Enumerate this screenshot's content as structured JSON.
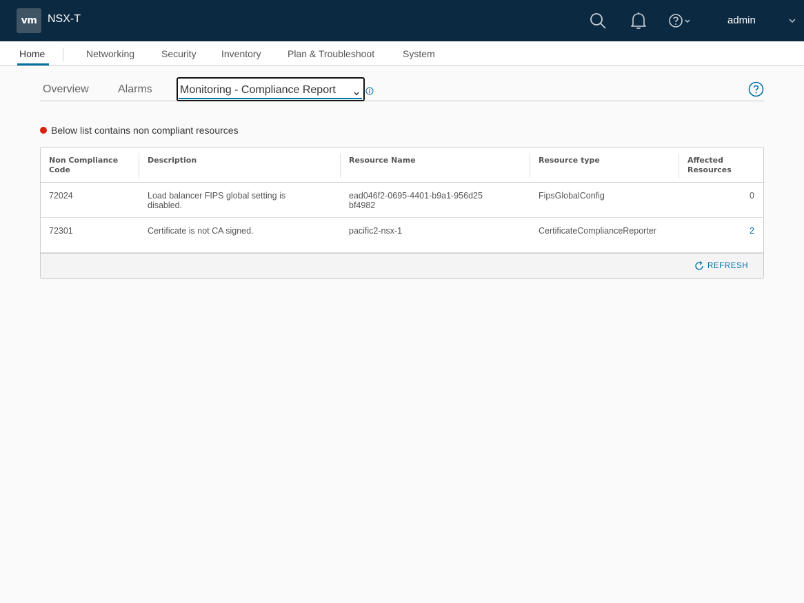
{
  "header": {
    "logo_text": "vm",
    "app_title": "NSX-T",
    "user": "admin",
    "colors": {
      "bg": "#0b2940",
      "accent": "#0072a3",
      "alert": "#d6210f"
    }
  },
  "nav": {
    "items": [
      {
        "label": "Home",
        "active": true
      },
      {
        "label": "Networking"
      },
      {
        "label": "Security"
      },
      {
        "label": "Inventory"
      },
      {
        "label": "Plan & Troubleshoot"
      },
      {
        "label": "System"
      }
    ]
  },
  "subtabs": {
    "overview": "Overview",
    "alarms": "Alarms",
    "selected": "Monitoring - Compliance Report"
  },
  "notice": "Below list contains non compliant resources",
  "table": {
    "columns": [
      "Non Compliance Code",
      "Description",
      "Resource Name",
      "Resource type",
      "Affected Resources"
    ],
    "rows": [
      {
        "code": "72024",
        "description": "Load balancer FIPS global setting is disabled.",
        "resource_name": "ead046f2-0695-4401-b9a1-956d25bf4982",
        "resource_type": "FipsGlobalConfig",
        "affected": "0"
      },
      {
        "code": "72301",
        "description": "Certificate is not CA signed.",
        "resource_name": "pacific2-nsx-1",
        "resource_type": "CertificateComplianceReporter",
        "affected": "2"
      }
    ],
    "refresh_label": "REFRESH"
  }
}
